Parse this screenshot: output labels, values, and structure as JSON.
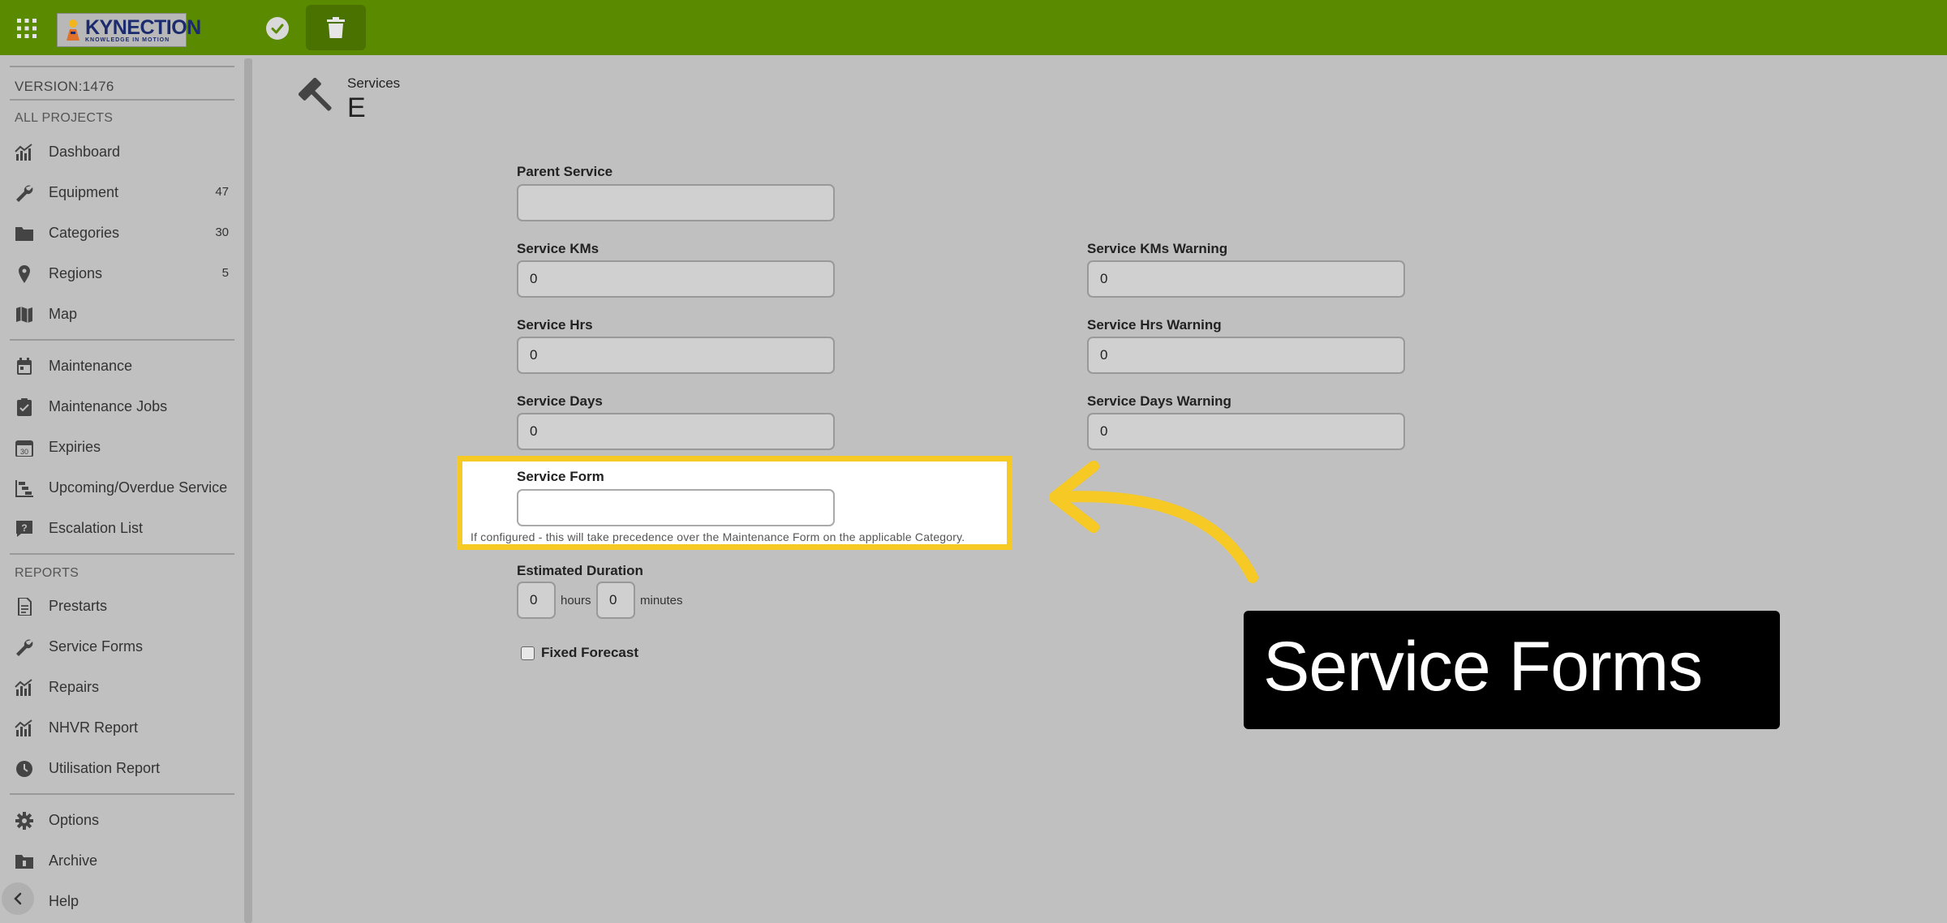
{
  "app": {
    "logo_text": "KYNECTION",
    "logo_tagline": "KNOWLEDGE IN MOTION"
  },
  "toolbar": {
    "icons": [
      "apps-grid-icon",
      "check-circle-icon",
      "trash-icon"
    ]
  },
  "sidebar": {
    "version": "VERSION:1476",
    "section_projects": "ALL PROJECTS",
    "section_reports": "REPORTS",
    "items": [
      {
        "label": "Dashboard",
        "icon": "bar-chart-icon"
      },
      {
        "label": "Equipment",
        "icon": "wrench-icon",
        "count": "47"
      },
      {
        "label": "Categories",
        "icon": "folder-icon",
        "count": "30"
      },
      {
        "label": "Regions",
        "icon": "map-pin-icon",
        "count": "5"
      },
      {
        "label": "Map",
        "icon": "map-icon"
      },
      {
        "label": "Maintenance",
        "icon": "calendar-icon"
      },
      {
        "label": "Maintenance Jobs",
        "icon": "clipboard-check-icon"
      },
      {
        "label": "Expiries",
        "icon": "calendar-30-icon"
      },
      {
        "label": "Upcoming/Overdue Service",
        "icon": "timeline-icon"
      },
      {
        "label": "Escalation List",
        "icon": "help-chat-icon"
      },
      {
        "label": "Prestarts",
        "icon": "document-icon"
      },
      {
        "label": "Service Forms",
        "icon": "wrench-icon"
      },
      {
        "label": "Repairs",
        "icon": "bar-chart-icon"
      },
      {
        "label": "NHVR Report",
        "icon": "bar-chart-icon"
      },
      {
        "label": "Utilisation Report",
        "icon": "clock-icon"
      },
      {
        "label": "Options",
        "icon": "gear-icon"
      },
      {
        "label": "Archive",
        "icon": "archive-folder-icon"
      },
      {
        "label": "Help",
        "icon": "help-icon"
      }
    ]
  },
  "page": {
    "section": "Services",
    "title": "E"
  },
  "form": {
    "parent_service_label": "Parent Service",
    "parent_service_value": "",
    "service_kms_label": "Service KMs",
    "service_kms_value": "0",
    "service_kms_warning_label": "Service KMs Warning",
    "service_kms_warning_value": "0",
    "service_hrs_label": "Service Hrs",
    "service_hrs_value": "0",
    "service_hrs_warning_label": "Service Hrs Warning",
    "service_hrs_warning_value": "0",
    "service_days_label": "Service Days",
    "service_days_value": "0",
    "service_days_warning_label": "Service Days Warning",
    "service_days_warning_value": "0",
    "service_form_label": "Service Form",
    "service_form_value": "",
    "service_form_helper": "If configured - this will take precedence over the Maintenance Form on the applicable Category.",
    "estimated_duration_label": "Estimated Duration",
    "duration_hours_value": "0",
    "hours_unit": "hours",
    "duration_minutes_value": "0",
    "minutes_unit": "minutes",
    "fixed_forecast_label": "Fixed Forecast",
    "fixed_forecast_checked": false
  },
  "annotation": {
    "caption": "Service Forms",
    "highlight_color": "#f7c925"
  }
}
